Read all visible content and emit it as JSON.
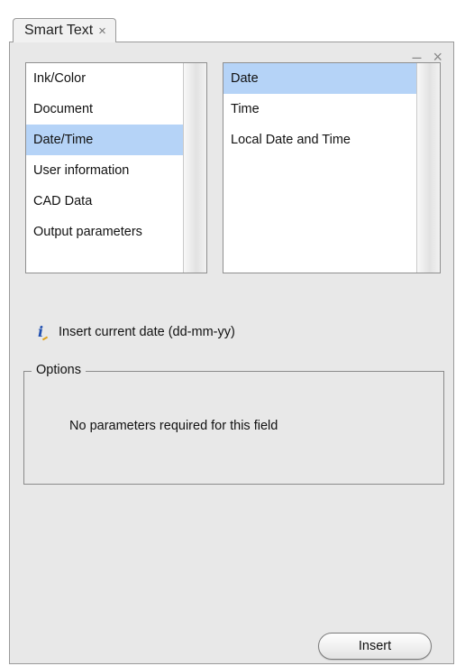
{
  "tab": {
    "title": "Smart Text",
    "close_glyph": "×"
  },
  "window_controls": {
    "minimize_glyph": "–",
    "close_glyph": "×"
  },
  "categories": {
    "items": [
      {
        "label": "Ink/Color",
        "selected": false
      },
      {
        "label": "Document",
        "selected": false
      },
      {
        "label": "Date/Time",
        "selected": true
      },
      {
        "label": "User information",
        "selected": false
      },
      {
        "label": "CAD Data",
        "selected": false
      },
      {
        "label": "Output parameters",
        "selected": false
      }
    ]
  },
  "fields": {
    "items": [
      {
        "label": "Date",
        "selected": true
      },
      {
        "label": "Time",
        "selected": false
      },
      {
        "label": "Local Date and Time",
        "selected": false
      }
    ]
  },
  "info": {
    "icon": "info-icon",
    "glyph": "i",
    "text": "Insert current date (dd-mm-yy)"
  },
  "options": {
    "legend": "Options",
    "message": "No parameters required for this field"
  },
  "actions": {
    "insert_label": "Insert"
  },
  "colors": {
    "selection": "#b5d3f7",
    "panel_bg": "#e8e8e8",
    "info_icon": "#1f4fb0"
  }
}
